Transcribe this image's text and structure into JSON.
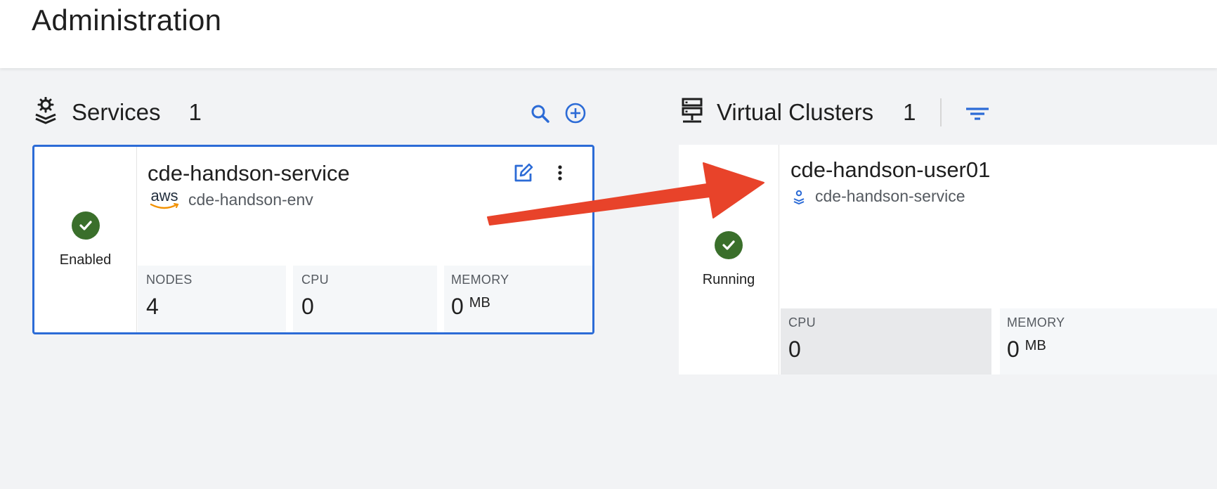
{
  "page": {
    "title": "Administration"
  },
  "services": {
    "title": "Services",
    "count": "1",
    "card": {
      "name": "cde-handson-service",
      "provider": "aws",
      "environment": "cde-handson-env",
      "status": "Enabled",
      "metrics": [
        {
          "label": "NODES",
          "value": "4",
          "unit": ""
        },
        {
          "label": "CPU",
          "value": "0",
          "unit": ""
        },
        {
          "label": "MEMORY",
          "value": "0",
          "unit": "MB"
        }
      ]
    }
  },
  "virtual_clusters": {
    "title": "Virtual Clusters",
    "count": "1",
    "card": {
      "name": "cde-handson-user01",
      "service": "cde-handson-service",
      "status": "Running",
      "metrics": [
        {
          "label": "CPU",
          "value": "0",
          "unit": ""
        },
        {
          "label": "MEMORY",
          "value": "0",
          "unit": "MB"
        }
      ]
    }
  },
  "colors": {
    "accent": "#2c6bd6",
    "status_ok": "#3a6f2b",
    "annotation_arrow": "#e8432a"
  }
}
